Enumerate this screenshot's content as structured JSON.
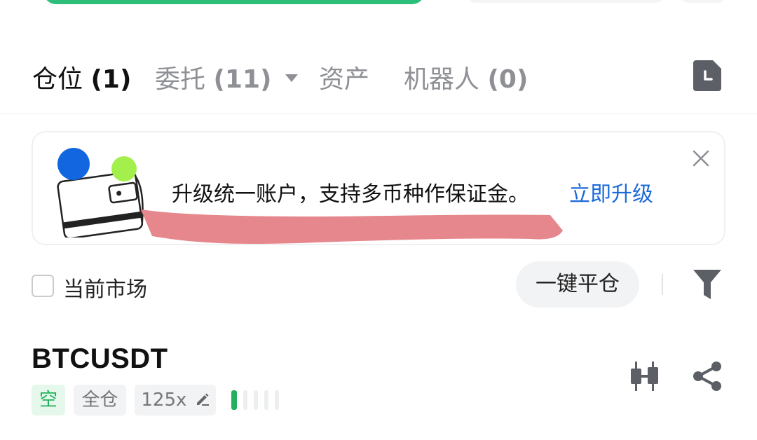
{
  "tabs": [
    {
      "label": "仓位",
      "count": "(1)",
      "active": true
    },
    {
      "label": "委托",
      "count": "(11)",
      "active": false
    },
    {
      "label": "资产",
      "count": "",
      "active": false
    },
    {
      "label": "机器人",
      "count": "(0)",
      "active": false
    }
  ],
  "banner": {
    "text": "升级统一账户，支持多币种作保证金。",
    "link": "立即升级"
  },
  "filters": {
    "current_market_label": "当前市场",
    "current_market_checked": false,
    "close_all_label": "一键平仓"
  },
  "position": {
    "symbol": "BTCUSDT",
    "side": "空",
    "margin_mode": "全仓",
    "leverage": "125x",
    "risk_level": 1,
    "risk_max": 5
  },
  "colors": {
    "green": "#22b25c",
    "link_blue": "#1c6ad8",
    "muted": "#8e9095"
  },
  "icons": [
    "history-icon",
    "close-icon",
    "filter-icon",
    "edit-icon",
    "candlestick-chart-icon",
    "share-icon"
  ]
}
